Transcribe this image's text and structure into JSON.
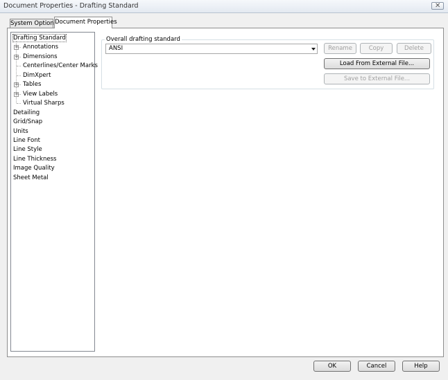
{
  "window": {
    "title": "Document Properties - Drafting Standard",
    "close_icon": "close-icon"
  },
  "tabs": [
    {
      "label": "System Options",
      "active": false
    },
    {
      "label": "Document Properties",
      "active": true
    }
  ],
  "tree": {
    "items": [
      {
        "label": "Drafting Standard",
        "level": 0,
        "expandable": false,
        "selected": true
      },
      {
        "label": "Annotations",
        "level": 1,
        "expandable": true
      },
      {
        "label": "Dimensions",
        "level": 1,
        "expandable": true
      },
      {
        "label": "Centerlines/Center Marks",
        "level": 1,
        "expandable": false
      },
      {
        "label": "DimXpert",
        "level": 1,
        "expandable": false
      },
      {
        "label": "Tables",
        "level": 1,
        "expandable": true
      },
      {
        "label": "View Labels",
        "level": 1,
        "expandable": true
      },
      {
        "label": "Virtual Sharps",
        "level": 1,
        "expandable": false
      },
      {
        "label": "Detailing",
        "level": 0,
        "expandable": false
      },
      {
        "label": "Grid/Snap",
        "level": 0,
        "expandable": false
      },
      {
        "label": "Units",
        "level": 0,
        "expandable": false
      },
      {
        "label": "Line Font",
        "level": 0,
        "expandable": false
      },
      {
        "label": "Line Style",
        "level": 0,
        "expandable": false
      },
      {
        "label": "Line Thickness",
        "level": 0,
        "expandable": false
      },
      {
        "label": "Image Quality",
        "level": 0,
        "expandable": false
      },
      {
        "label": "Sheet Metal",
        "level": 0,
        "expandable": false
      }
    ]
  },
  "standard": {
    "group_label": "Overall drafting standard",
    "selected_value": "ANSI",
    "rename_label": "Rename",
    "copy_label": "Copy",
    "delete_label": "Delete",
    "load_label": "Load From External File...",
    "save_label": "Save to External File..."
  },
  "footer": {
    "ok_label": "OK",
    "cancel_label": "Cancel",
    "help_label": "Help"
  }
}
